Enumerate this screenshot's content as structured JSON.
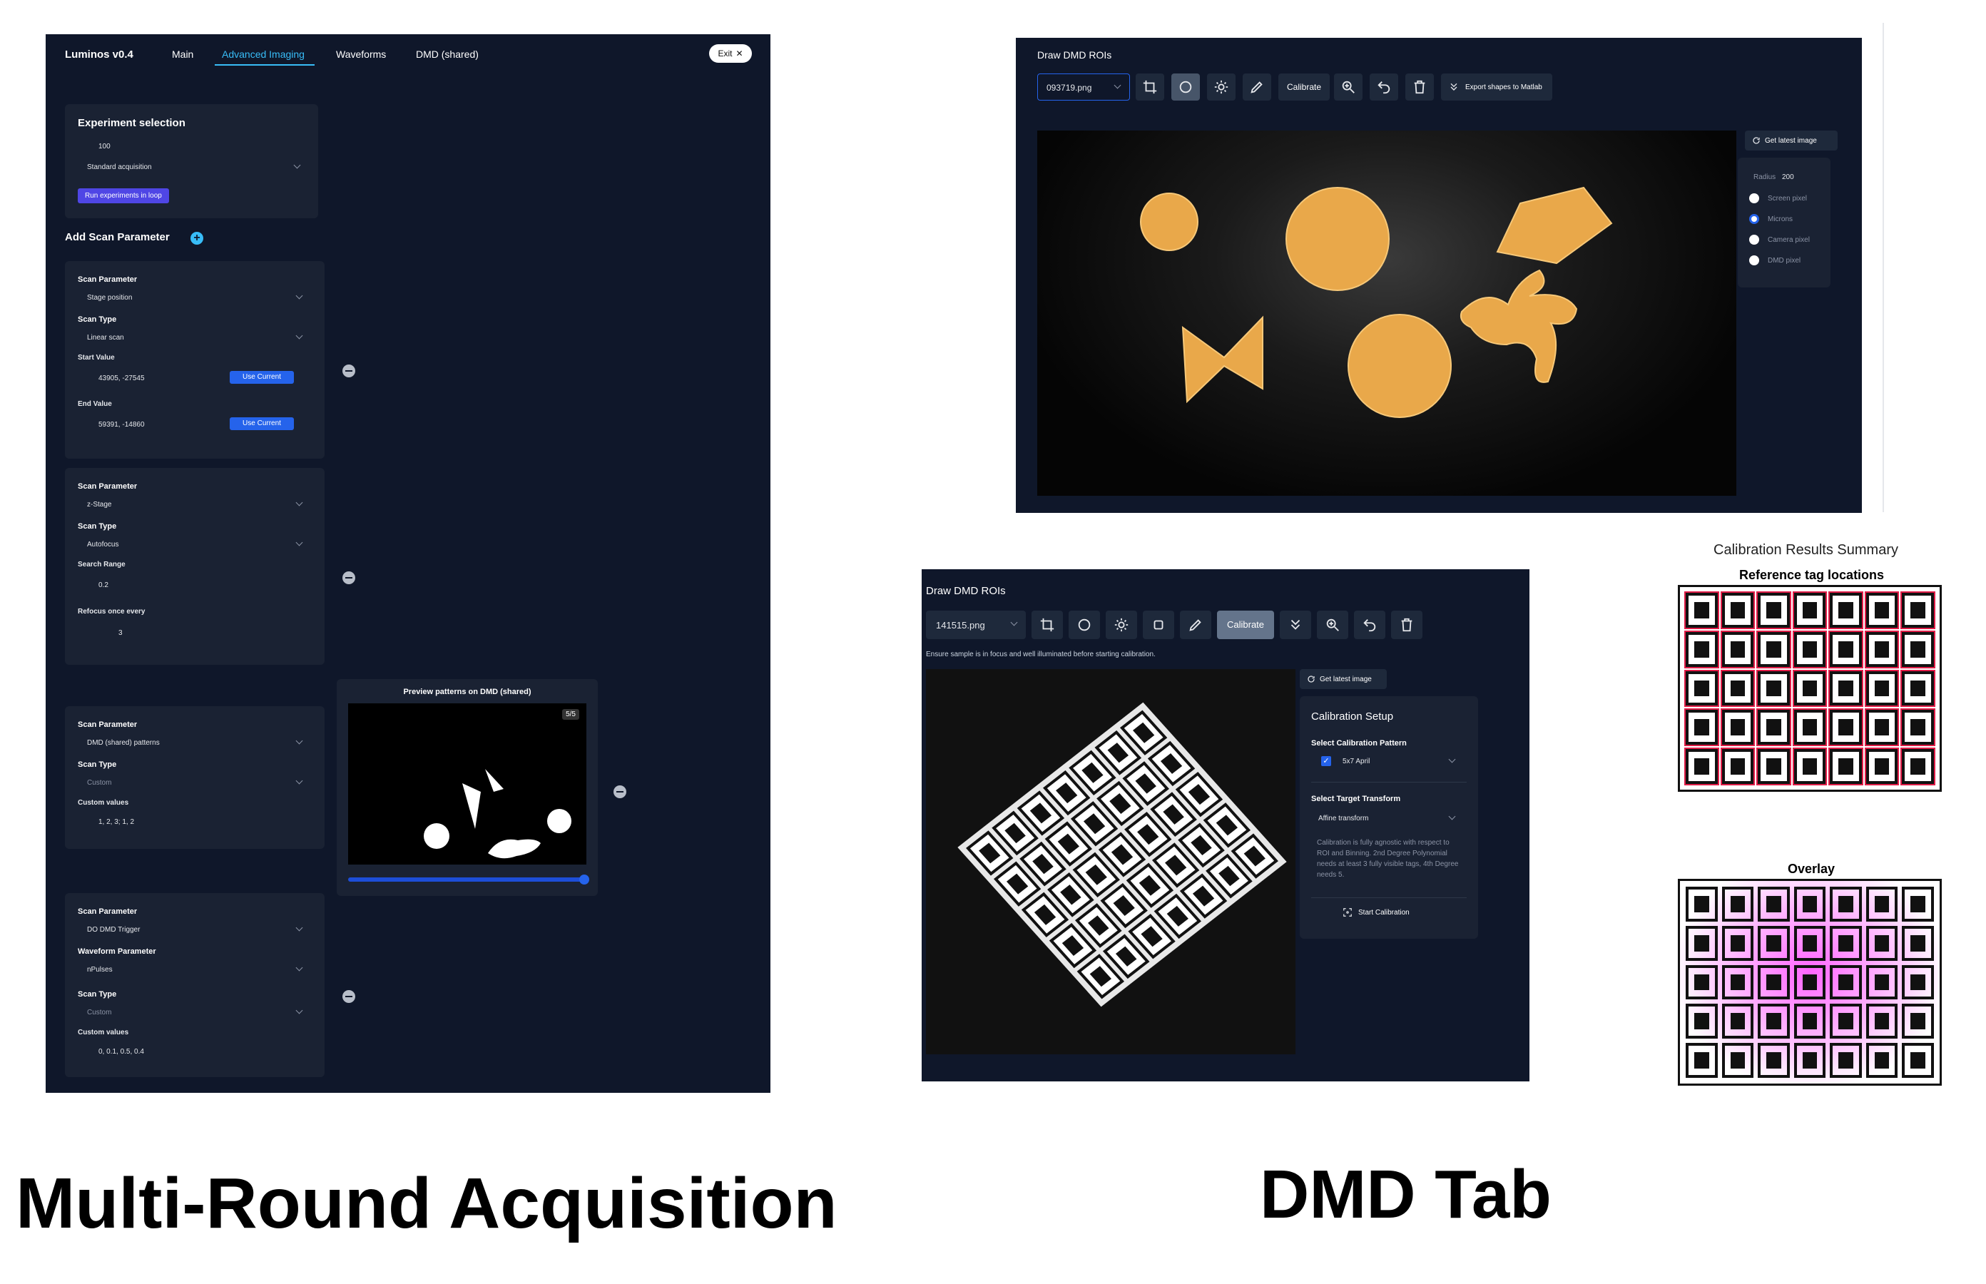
{
  "captions": {
    "left": "Multi-Round Acquisition",
    "right": "DMD Tab"
  },
  "luminos": {
    "app_title": "Luminos v0.4",
    "tabs": [
      "Main",
      "Advanced Imaging",
      "Waveforms",
      "DMD (shared)"
    ],
    "active_tab": "Advanced Imaging",
    "exit_label": "Exit",
    "experiment": {
      "title": "Experiment selection",
      "count": "100",
      "mode": "Standard acquisition",
      "run_button": "Run experiments in loop"
    },
    "add_scan_label": "Add Scan Parameter",
    "scan_cards": [
      {
        "param_label": "Scan Parameter",
        "param_value": "Stage position",
        "type_label": "Scan Type",
        "type_value": "Linear scan",
        "f1_label": "Start Value",
        "f1_value": "43905, -27545",
        "f1_button": "Use Current",
        "f2_label": "End Value",
        "f2_value": "59391, -14860",
        "f2_button": "Use Current"
      },
      {
        "param_label": "Scan Parameter",
        "param_value": "z-Stage",
        "type_label": "Scan Type",
        "type_value": "Autofocus",
        "f1_label": "Search Range",
        "f1_value": "0.2",
        "f2_label": "Refocus once every",
        "f2_value": "3"
      },
      {
        "param_label": "Scan Parameter",
        "param_value": "DMD (shared) patterns",
        "type_label": "Scan Type",
        "type_value": "Custom",
        "f1_label": "Custom values",
        "f1_value": "1, 2, 3; 1, 2"
      },
      {
        "param_label": "Scan Parameter",
        "param_value": "DO DMD Trigger",
        "wave_label": "Waveform Parameter",
        "wave_value": "nPulses",
        "type_label": "Scan Type",
        "type_value": "Custom",
        "f1_label": "Custom values",
        "f1_value": "0, 0.1, 0.5, 0.4"
      }
    ],
    "preview": {
      "title": "Preview patterns on DMD (shared)",
      "badge": "5/5",
      "slider_fraction": 1.0
    }
  },
  "dmd_top": {
    "title": "Draw DMD ROIs",
    "file": "093719.png",
    "calibrate_label": "Calibrate",
    "export_label": "Export shapes to Matlab",
    "get_latest": "Get latest image",
    "radius_label": "Radius",
    "radius_value": "200",
    "units": [
      "Screen pixel",
      "Microns",
      "Camera pixel",
      "DMD pixel"
    ],
    "selected_unit": "Microns"
  },
  "dmd_bottom": {
    "title": "Draw DMD ROIs",
    "file": "141515.png",
    "calibrate_label": "Calibrate",
    "hint": "Ensure sample is in focus and well illuminated before starting calibration.",
    "get_latest": "Get latest image",
    "setup": {
      "title": "Calibration Setup",
      "pattern_label": "Select Calibration Pattern",
      "pattern_value": "5x7 April",
      "transform_label": "Select Target Transform",
      "transform_value": "Affine transform",
      "note": "Calibration is fully agnostic with respect to ROI and Binning. 2nd Degree Polynomial needs at least 3 fully visible tags, 4th Degree needs 5.",
      "start_label": "Start Calibration"
    }
  },
  "calibration_results": {
    "title": "Calibration Results Summary",
    "ref_label": "Reference tag locations",
    "overlay_label": "Overlay"
  },
  "colors": {
    "panel_bg": "#0f172a",
    "card_bg": "#1a2233",
    "accent_blue": "#2563eb",
    "purple_button": "#4f46e5",
    "tab_active": "#38bdf8",
    "blob": "#e9a84a",
    "overlay_pink": "#ff66ff"
  },
  "icons": [
    "plus-circle-icon",
    "minus-circle-icon",
    "chevron-down-icon",
    "crop-icon",
    "circle-icon",
    "sun-icon",
    "pencil-icon",
    "zoom-icon",
    "undo-icon",
    "trash-icon",
    "double-chevron-icon",
    "refresh-icon",
    "crosshair-icon",
    "close-icon"
  ]
}
